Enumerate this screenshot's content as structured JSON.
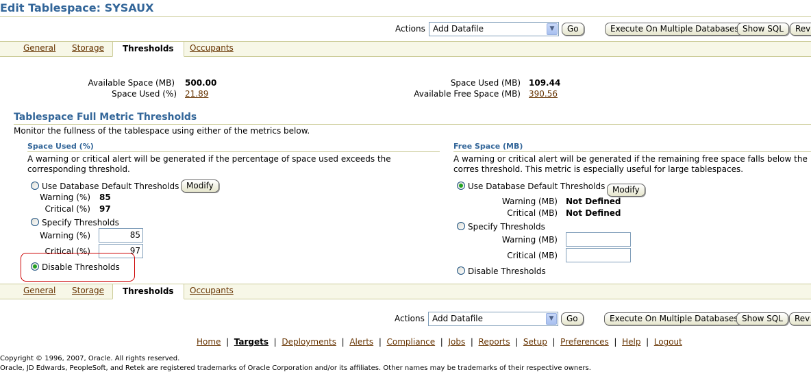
{
  "page_title": "Edit Tablespace: SYSAUX",
  "actions": {
    "label": "Actions",
    "selected": "Add Datafile",
    "go_label": "Go",
    "execute_label": "Execute On Multiple Databases",
    "show_sql_label": "Show SQL",
    "revert_label": "Rev"
  },
  "tabs": [
    {
      "label": "General",
      "active": false
    },
    {
      "label": "Storage",
      "active": false
    },
    {
      "label": "Thresholds",
      "active": true
    },
    {
      "label": "Occupants",
      "active": false
    }
  ],
  "summary": {
    "available_space_label": "Available Space (MB)",
    "available_space_value": "500.00",
    "space_used_pct_label": "Space Used (%)",
    "space_used_pct_value": "21.89",
    "space_used_mb_label": "Space Used (MB)",
    "space_used_mb_value": "109.44",
    "available_free_label": "Available Free Space (MB)",
    "available_free_value": "390.56"
  },
  "section": {
    "title": "Tablespace Full Metric Thresholds",
    "description": "Monitor the fullness of the tablespace using either of the metrics below."
  },
  "space_used": {
    "heading": "Space Used (%)",
    "description": "A warning or critical alert will be generated if the percentage of space used exceeds the corresponding threshold.",
    "default_option": "Use Database Default Thresholds",
    "modify_label": "Modify",
    "default_warning_label": "Warning (%)",
    "default_warning_value": "85",
    "default_critical_label": "Critical (%)",
    "default_critical_value": "97",
    "specify_option": "Specify Thresholds",
    "warning_label": "Warning (%)",
    "warning_input": "85",
    "critical_label": "Critical (%)",
    "critical_input": "97",
    "disable_option": "Disable Thresholds",
    "selected": "disable"
  },
  "free_space": {
    "heading": "Free Space (MB)",
    "description": "A warning or critical alert will be generated if the remaining free space falls below the corres threshold. This metric is especially useful for large tablespaces.",
    "default_option": "Use Database Default Thresholds",
    "modify_label": "Modify",
    "default_warning_label": "Warning (MB)",
    "default_warning_value": "Not Defined",
    "default_critical_label": "Critical (MB)",
    "default_critical_value": "Not Defined",
    "specify_option": "Specify Thresholds",
    "warning_label": "Warning (MB)",
    "warning_input": "",
    "critical_label": "Critical (MB)",
    "critical_input": "",
    "disable_option": "Disable Thresholds",
    "selected": "default"
  },
  "footer_links": [
    "Home",
    "Targets",
    "Deployments",
    "Alerts",
    "Compliance",
    "Jobs",
    "Reports",
    "Setup",
    "Preferences",
    "Help",
    "Logout"
  ],
  "copyright": "Copyright © 1996, 2007, Oracle. All rights reserved.",
  "trademark": "Oracle, JD Edwards, PeopleSoft, and Retek are registered trademarks of Oracle Corporation and/or its affiliates. Other names may be trademarks of their respective owners.",
  "colors": {
    "accent": "#336699",
    "link": "#663300",
    "rule": "#cccc99",
    "tab_bg": "#f7f7e7"
  }
}
